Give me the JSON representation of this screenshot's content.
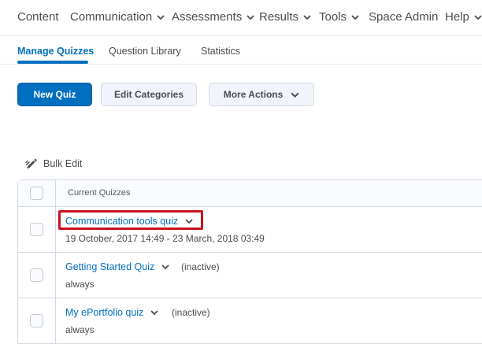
{
  "topnav": {
    "items": [
      {
        "label": "Content",
        "has_menu": false
      },
      {
        "label": "Communication",
        "has_menu": true
      },
      {
        "label": "Assessments",
        "has_menu": true
      },
      {
        "label": "Results",
        "has_menu": true
      },
      {
        "label": "Tools",
        "has_menu": true
      },
      {
        "label": "Space Admin",
        "has_menu": false
      },
      {
        "label": "Help",
        "has_menu": true
      }
    ]
  },
  "subtabs": {
    "items": [
      {
        "label": "Manage Quizzes",
        "active": true
      },
      {
        "label": "Question Library",
        "active": false
      },
      {
        "label": "Statistics",
        "active": false
      }
    ]
  },
  "toolbar": {
    "new_quiz_label": "New Quiz",
    "edit_categories_label": "Edit Categories",
    "more_actions_label": "More Actions"
  },
  "bulk_edit_label": "Bulk Edit",
  "table": {
    "header_label": "Current Quizzes",
    "rows": [
      {
        "name": "Communication tools quiz",
        "status": "",
        "dates": "19 October, 2017 14:49 - 23 March, 2018 03:49",
        "highlighted": true
      },
      {
        "name": "Getting Started Quiz",
        "status": "(inactive)",
        "dates": "always",
        "highlighted": false
      },
      {
        "name": "My ePortfolio quiz",
        "status": "(inactive)",
        "dates": "always",
        "highlighted": false
      }
    ]
  },
  "colors": {
    "accent": "#006fbf",
    "highlight_border": "#c8101e",
    "text": "#494c4e"
  }
}
